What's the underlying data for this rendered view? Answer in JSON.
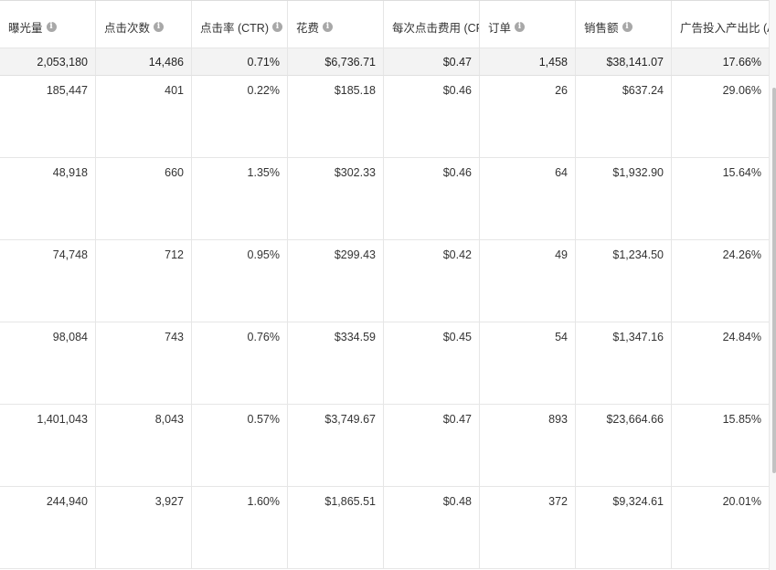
{
  "columns": [
    {
      "label": "曝光量"
    },
    {
      "label": "点击次数"
    },
    {
      "label": "点击率 (CTR)"
    },
    {
      "label": "花费"
    },
    {
      "label": "每次点击费用 (CPC)"
    },
    {
      "label": "订单"
    },
    {
      "label": "销售额"
    },
    {
      "label": "广告投入产出比 (ACOS)"
    }
  ],
  "info_icon": "info-icon",
  "summary": [
    "2,053,180",
    "14,486",
    "0.71%",
    "$6,736.71",
    "$0.47",
    "1,458",
    "$38,141.07",
    "17.66%"
  ],
  "rows": [
    [
      "185,447",
      "401",
      "0.22%",
      "$185.18",
      "$0.46",
      "26",
      "$637.24",
      "29.06%"
    ],
    [
      "48,918",
      "660",
      "1.35%",
      "$302.33",
      "$0.46",
      "64",
      "$1,932.90",
      "15.64%"
    ],
    [
      "74,748",
      "712",
      "0.95%",
      "$299.43",
      "$0.42",
      "49",
      "$1,234.50",
      "24.26%"
    ],
    [
      "98,084",
      "743",
      "0.76%",
      "$334.59",
      "$0.45",
      "54",
      "$1,347.16",
      "24.84%"
    ],
    [
      "1,401,043",
      "8,043",
      "0.57%",
      "$3,749.67",
      "$0.47",
      "893",
      "$23,664.66",
      "15.85%"
    ],
    [
      "244,940",
      "3,927",
      "1.60%",
      "$1,865.51",
      "$0.48",
      "372",
      "$9,324.61",
      "20.01%"
    ]
  ]
}
